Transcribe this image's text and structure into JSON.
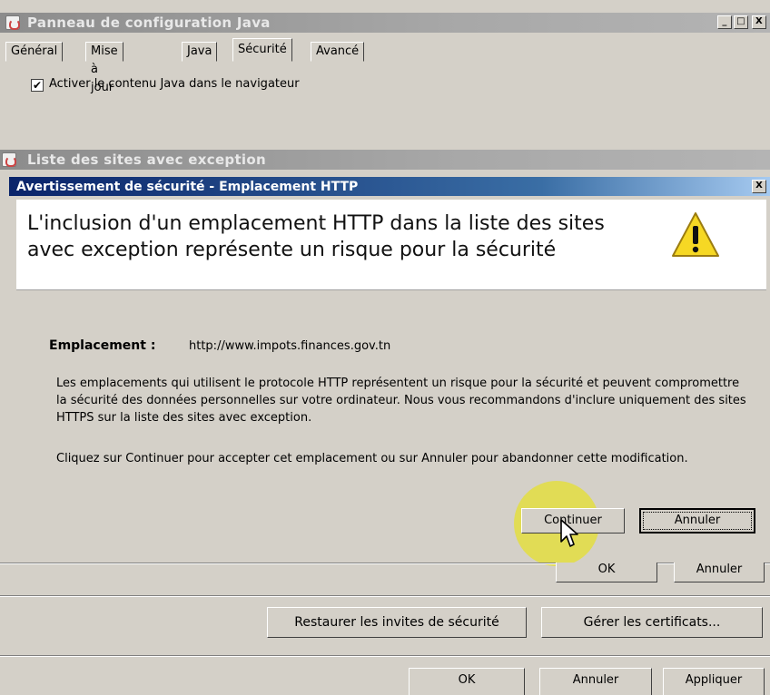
{
  "main_window": {
    "title": "Panneau de configuration Java",
    "controls": {
      "minimize": "_",
      "maximize": "□",
      "close": "X"
    }
  },
  "tabs": [
    {
      "label": "Général"
    },
    {
      "label": "Mise à jour"
    },
    {
      "label": "Java"
    },
    {
      "label": "Sécurité",
      "active": true
    },
    {
      "label": "Avancé"
    }
  ],
  "security_tab": {
    "enable_java_label": "Activer le contenu Java dans le navigateur",
    "enable_java_checked": "✔"
  },
  "exception_list_window": {
    "title": "Liste des sites avec exception"
  },
  "warning_dialog": {
    "title": "Avertissement de sécurité - Emplacement HTTP",
    "close": "X",
    "headline": "L'inclusion d'un emplacement HTTP dans la liste des sites avec exception représente un risque pour la sécurité",
    "icon": "warning-triangle-icon",
    "location_label": "Emplacement :",
    "location_url": "http://www.impots.finances.gov.tn",
    "paragraph_1": "Les emplacements qui utilisent le protocole HTTP représentent un risque pour la sécurité et peuvent compromettre la sécurité des données personnelles sur votre ordinateur. Nous vous recommandons d'inclure uniquement des sites HTTPS sur la liste des sites avec exception.",
    "paragraph_2": "Cliquez sur Continuer pour accepter cet emplacement ou sur Annuler pour abandonner cette modification.",
    "continue_button": "Continuer",
    "cancel_button": "Annuler"
  },
  "exception_list_buttons": {
    "ok": "OK",
    "cancel": "Annuler"
  },
  "security_buttons": {
    "restore_prompts": "Restaurer les invites de sécurité",
    "manage_certs": "Gérer les certificats..."
  },
  "main_buttons": {
    "ok": "OK",
    "cancel": "Annuler",
    "apply": "Appliquer"
  },
  "colors": {
    "dialog_title_bar": "#0a246a",
    "inactive_title_bar": "#9a9a9a",
    "click_highlight": "#e6e128"
  }
}
